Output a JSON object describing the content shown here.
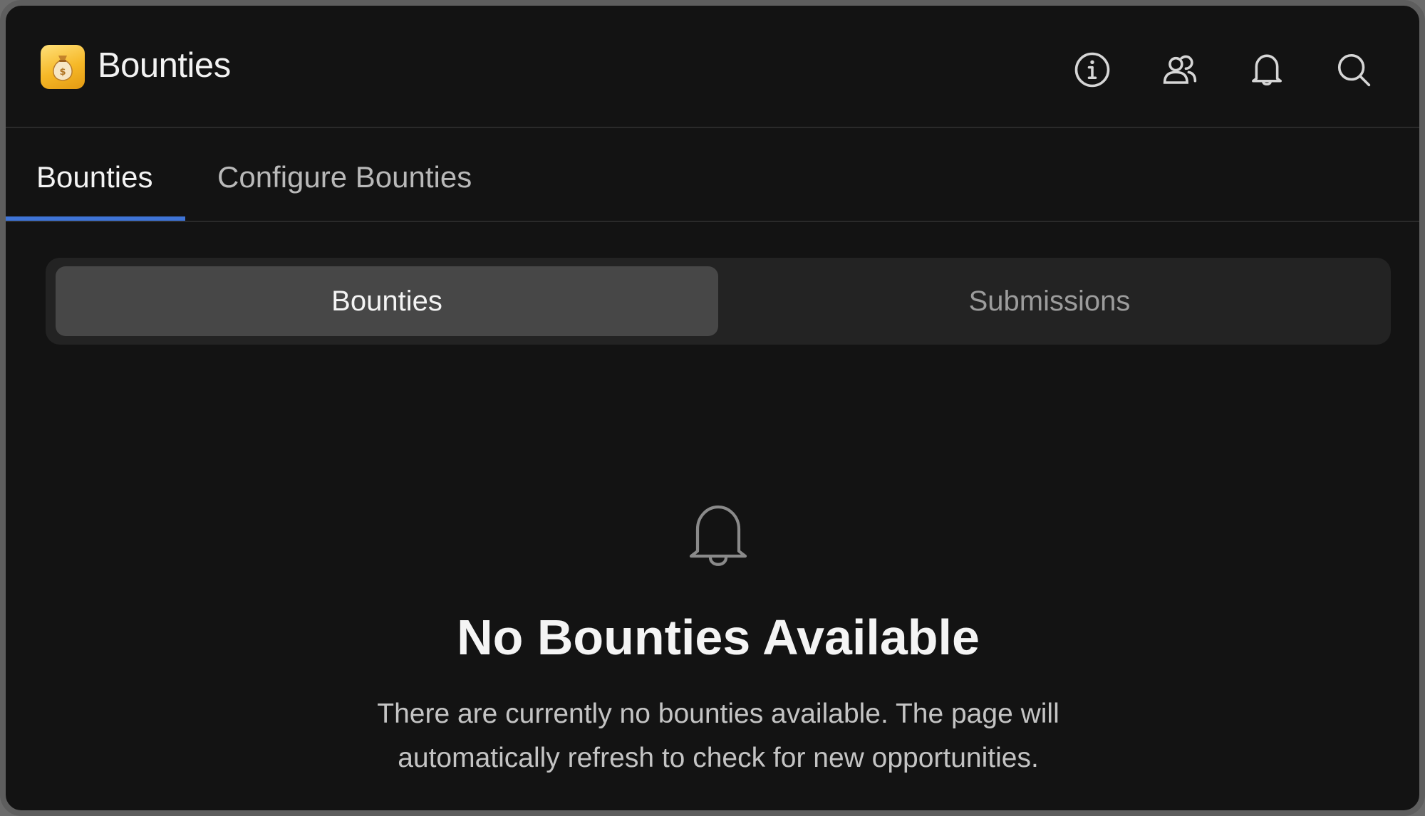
{
  "app": {
    "title": "Bounties",
    "icon": "money-bag-icon"
  },
  "header_actions": [
    {
      "name": "info-icon"
    },
    {
      "name": "users-icon"
    },
    {
      "name": "bell-icon"
    },
    {
      "name": "search-icon"
    }
  ],
  "tabs": [
    {
      "label": "Bounties",
      "active": true
    },
    {
      "label": "Configure Bounties",
      "active": false
    }
  ],
  "segment": {
    "options": [
      "Bounties",
      "Submissions"
    ],
    "selected": "Bounties"
  },
  "empty_state": {
    "icon": "bell-icon",
    "title": "No Bounties Available",
    "description": "There are currently no bounties available. The page will automatically refresh to check for new opportunities."
  },
  "colors": {
    "background": "#131313",
    "accent": "#3f74d6",
    "segment_bg": "#232323",
    "segment_active": "#474747",
    "app_icon": "#f6b827"
  }
}
